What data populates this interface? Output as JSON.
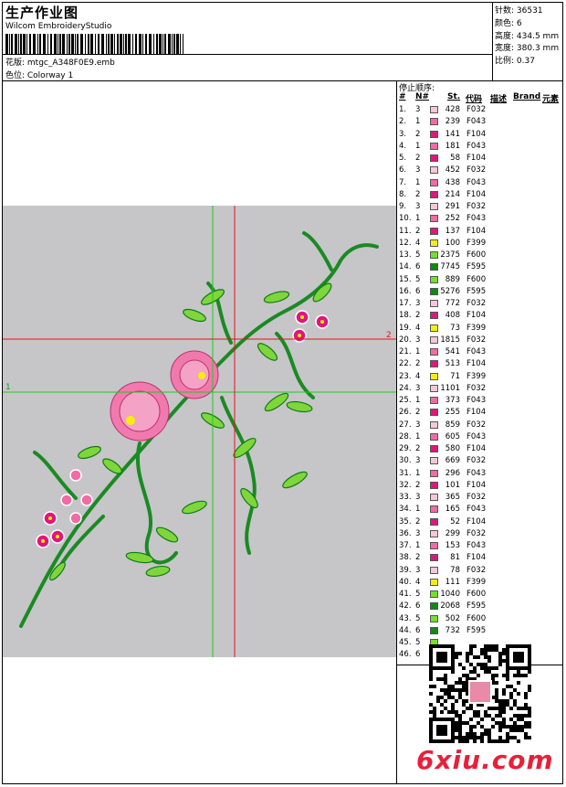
{
  "header": {
    "title": "生产作业图",
    "vendor": "Wilcom EmbroideryStudio",
    "design": "花版:  mtgc_A348F0E9.emb",
    "colorway": "色位:  Colorway 1"
  },
  "stats": [
    {
      "label": "针数:",
      "value": "36531"
    },
    {
      "label": "颜色:",
      "value": "6"
    },
    {
      "label": "高度:",
      "value": "434.5 mm"
    },
    {
      "label": "宽度:",
      "value": "380.3 mm"
    },
    {
      "label": "比例:",
      "value": "0.37"
    }
  ],
  "stop_sequence": {
    "title": "停止顺序:",
    "headers": [
      "#",
      "N#",
      "St.",
      "代码",
      "描述",
      "Brand",
      "元素"
    ],
    "rows": [
      {
        "i": "1.",
        "n": "3",
        "st": "428",
        "code": "F032",
        "color": "#f7c6d8"
      },
      {
        "i": "2.",
        "n": "1",
        "st": "239",
        "code": "F043",
        "color": "#f36aa4"
      },
      {
        "i": "3.",
        "n": "2",
        "st": "141",
        "code": "F104",
        "color": "#e3147a"
      },
      {
        "i": "4.",
        "n": "1",
        "st": "181",
        "code": "F043",
        "color": "#f36aa4"
      },
      {
        "i": "5.",
        "n": "2",
        "st": "58",
        "code": "F104",
        "color": "#e3147a"
      },
      {
        "i": "6.",
        "n": "3",
        "st": "452",
        "code": "F032",
        "color": "#f7c6d8"
      },
      {
        "i": "7.",
        "n": "1",
        "st": "438",
        "code": "F043",
        "color": "#f36aa4"
      },
      {
        "i": "8.",
        "n": "2",
        "st": "214",
        "code": "F104",
        "color": "#e3147a"
      },
      {
        "i": "9.",
        "n": "3",
        "st": "291",
        "code": "F032",
        "color": "#f7c6d8"
      },
      {
        "i": "10.",
        "n": "1",
        "st": "252",
        "code": "F043",
        "color": "#f36aa4"
      },
      {
        "i": "11.",
        "n": "2",
        "st": "137",
        "code": "F104",
        "color": "#e3147a"
      },
      {
        "i": "12.",
        "n": "4",
        "st": "100",
        "code": "F399",
        "color": "#f5ee10"
      },
      {
        "i": "13.",
        "n": "5",
        "st": "2375",
        "code": "F600",
        "color": "#74e02a"
      },
      {
        "i": "14.",
        "n": "6",
        "st": "7745",
        "code": "F595",
        "color": "#0e8a18"
      },
      {
        "i": "15.",
        "n": "5",
        "st": "889",
        "code": "F600",
        "color": "#74e02a"
      },
      {
        "i": "16.",
        "n": "6",
        "st": "5276",
        "code": "F595",
        "color": "#0e8a18"
      },
      {
        "i": "17.",
        "n": "3",
        "st": "772",
        "code": "F032",
        "color": "#f7c6d8"
      },
      {
        "i": "18.",
        "n": "2",
        "st": "408",
        "code": "F104",
        "color": "#e3147a"
      },
      {
        "i": "19.",
        "n": "4",
        "st": "73",
        "code": "F399",
        "color": "#f5ee10"
      },
      {
        "i": "20.",
        "n": "3",
        "st": "1815",
        "code": "F032",
        "color": "#f7c6d8"
      },
      {
        "i": "21.",
        "n": "1",
        "st": "541",
        "code": "F043",
        "color": "#f36aa4"
      },
      {
        "i": "22.",
        "n": "2",
        "st": "513",
        "code": "F104",
        "color": "#e3147a"
      },
      {
        "i": "23.",
        "n": "4",
        "st": "71",
        "code": "F399",
        "color": "#f5ee10"
      },
      {
        "i": "24.",
        "n": "3",
        "st": "1101",
        "code": "F032",
        "color": "#f7c6d8"
      },
      {
        "i": "25.",
        "n": "1",
        "st": "373",
        "code": "F043",
        "color": "#f36aa4"
      },
      {
        "i": "26.",
        "n": "2",
        "st": "255",
        "code": "F104",
        "color": "#e3147a"
      },
      {
        "i": "27.",
        "n": "3",
        "st": "859",
        "code": "F032",
        "color": "#f7c6d8"
      },
      {
        "i": "28.",
        "n": "1",
        "st": "605",
        "code": "F043",
        "color": "#f36aa4"
      },
      {
        "i": "29.",
        "n": "2",
        "st": "580",
        "code": "F104",
        "color": "#e3147a"
      },
      {
        "i": "30.",
        "n": "3",
        "st": "669",
        "code": "F032",
        "color": "#f7c6d8"
      },
      {
        "i": "31.",
        "n": "1",
        "st": "296",
        "code": "F043",
        "color": "#f36aa4"
      },
      {
        "i": "32.",
        "n": "2",
        "st": "101",
        "code": "F104",
        "color": "#e3147a"
      },
      {
        "i": "33.",
        "n": "3",
        "st": "365",
        "code": "F032",
        "color": "#f7c6d8"
      },
      {
        "i": "34.",
        "n": "1",
        "st": "165",
        "code": "F043",
        "color": "#f36aa4"
      },
      {
        "i": "35.",
        "n": "2",
        "st": "52",
        "code": "F104",
        "color": "#e3147a"
      },
      {
        "i": "36.",
        "n": "3",
        "st": "299",
        "code": "F032",
        "color": "#f7c6d8"
      },
      {
        "i": "37.",
        "n": "1",
        "st": "153",
        "code": "F043",
        "color": "#f36aa4"
      },
      {
        "i": "38.",
        "n": "2",
        "st": "81",
        "code": "F104",
        "color": "#e3147a"
      },
      {
        "i": "39.",
        "n": "3",
        "st": "78",
        "code": "F032",
        "color": "#f7c6d8"
      },
      {
        "i": "40.",
        "n": "4",
        "st": "111",
        "code": "F399",
        "color": "#f5ee10"
      },
      {
        "i": "41.",
        "n": "5",
        "st": "1040",
        "code": "F600",
        "color": "#74e02a"
      },
      {
        "i": "42.",
        "n": "6",
        "st": "2068",
        "code": "F595",
        "color": "#0e8a18"
      },
      {
        "i": "43.",
        "n": "5",
        "st": "502",
        "code": "F600",
        "color": "#74e02a"
      },
      {
        "i": "44.",
        "n": "6",
        "st": "732",
        "code": "F595",
        "color": "#0e8a18"
      },
      {
        "i": "45.",
        "n": "5",
        "st": "",
        "code": "",
        "color": "#74e02a"
      },
      {
        "i": "46.",
        "n": "6",
        "st": "",
        "code": "",
        "color": "#0e8a18"
      }
    ]
  },
  "markers": {
    "h1": "1",
    "h2": "2"
  },
  "watermark": "6xiu.com"
}
